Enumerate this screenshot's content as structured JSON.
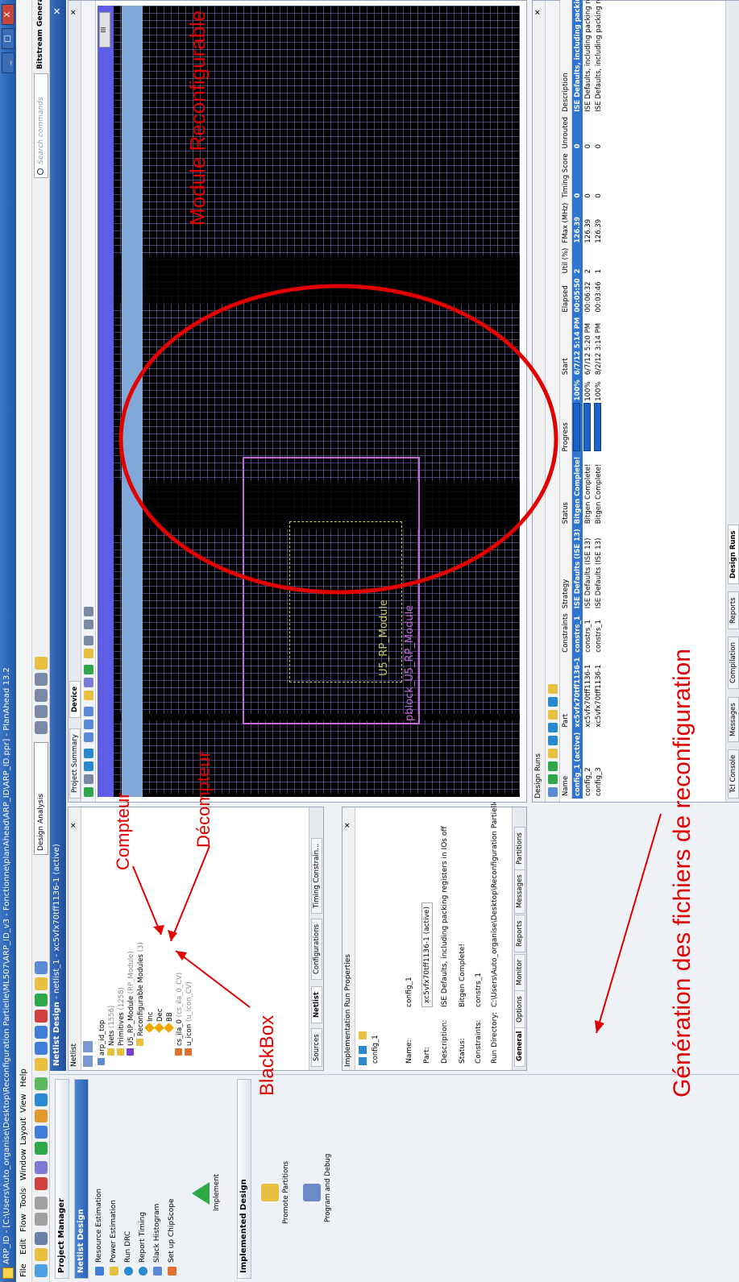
{
  "window": {
    "title": "ARP_ID - [C:\\Users\\Auto_organise\\Desktop\\Reconfiguration Partielle\\ML507\\ARP_ID_v3 - Fonctionne\\planAhead\\ARP_ID\\ARP_ID.ppr] - PlanAhead 13.2",
    "minimize": "_",
    "maximize": "□",
    "close": "X"
  },
  "menu": [
    "File",
    "Edit",
    "Flow",
    "Tools",
    "Window",
    "Layout",
    "View",
    "Help"
  ],
  "toolbar": {
    "layout_select": "Design Analysis",
    "search_placeholder": "Search commands",
    "status": "Bitstream Generated"
  },
  "flow_navigator": {
    "header": "Project Manager",
    "netlist_design": "Netlist Design",
    "items": [
      "Resource Estimation",
      "Power Estimation",
      "Run DRC",
      "Report Timing",
      "Slack Histogram",
      "Set up ChipScope"
    ],
    "implement": "Implement",
    "implemented_design": "Implemented Design",
    "promote": "Promote Partitions",
    "program": "Program and Debug"
  },
  "main_header": {
    "title": "Netlist Design",
    "subtitle": "- netlist_1 - xc5vfx70tff1136-1 (active)"
  },
  "netlist": {
    "title": "Netlist",
    "tree": [
      {
        "label": "arp_id_top",
        "extra": ""
      },
      {
        "label": "Nets",
        "extra": "(1556)"
      },
      {
        "label": "Primitives",
        "extra": "(1258)"
      },
      {
        "label": "U5_RP_Module",
        "extra": "(RP_Module)"
      },
      {
        "label": "Reconfigurable Modules",
        "extra": "(3)"
      },
      {
        "label": "Inc",
        "extra": ""
      },
      {
        "label": "Dec",
        "extra": ""
      },
      {
        "label": "BB",
        "extra": ""
      },
      {
        "label": "cs_ila_0",
        "extra": "(cs_ila_0_CV)"
      },
      {
        "label": "u_icon",
        "extra": "(u_icon_CV)"
      }
    ],
    "tabs": [
      "Sources",
      "Netlist",
      "Configurations",
      "Timing Constrain..."
    ]
  },
  "run_props": {
    "title": "Implementation Run Properties",
    "run": "config_1",
    "fields": [
      {
        "label": "Name:",
        "value": "config_1"
      },
      {
        "label": "Part:",
        "value": "xc5vfx70tff1136-1 (active)"
      },
      {
        "label": "Description:",
        "value": "ISE Defaults, including packing registers in IOs off"
      },
      {
        "label": "Status:",
        "value": "Bitgen Complete!"
      },
      {
        "label": "Constraints:",
        "value": "constrs_1"
      },
      {
        "label": "Run Directory:",
        "value": "C:\\Users\\Auto_organise\\Desktop\\Reconfiguration Partielle\\"
      }
    ],
    "tabs": [
      "General",
      "Options",
      "Monitor",
      "Reports",
      "Messages",
      "Partitions"
    ]
  },
  "device": {
    "tabs": [
      "Project Summary",
      "Device"
    ],
    "pblock_inner": "U5_RP_Module",
    "pblock_outer": "pblock_U5_RP_Module",
    "scroll_label": "III"
  },
  "design_runs": {
    "title": "Design Runs",
    "columns": [
      "Name",
      "Part",
      "Constraints",
      "Strategy",
      "Status",
      "Progress",
      "Start",
      "Elapsed",
      "Util (%)",
      "FMax (MHz)",
      "Timing Score",
      "Unrouted",
      "Description"
    ],
    "rows": [
      {
        "name": "config_1 (active)",
        "part": "xc5vfx70tff1136-1",
        "constraints": "constrs_1",
        "strategy": "ISE Defaults (ISE 13)",
        "status": "Bitgen Complete!",
        "progress": "100%",
        "start": "6/7/12 5:14 PM",
        "elapsed": "00:05:50",
        "util": "2",
        "fmax": "126.39",
        "timing": "0",
        "unrouted": "0",
        "description": "ISE Defaults, including packing registers in IOs off"
      },
      {
        "name": "config_2",
        "part": "xc5vfx70tff1136-1",
        "constraints": "constrs_1",
        "strategy": "ISE Defaults (ISE 13)",
        "status": "Bitgen Complete!",
        "progress": "100%",
        "start": "6/7/12 5:20 PM",
        "elapsed": "00:06:32",
        "util": "2",
        "fmax": "126.39",
        "timing": "0",
        "unrouted": "0",
        "description": "ISE Defaults, including packing registers in IOs off"
      },
      {
        "name": "config_3",
        "part": "xc5vfx70tff1136-1",
        "constraints": "constrs_1",
        "strategy": "ISE Defaults (ISE 13)",
        "status": "Bitgen Complete!",
        "progress": "100%",
        "start": "8/2/12 3:14 PM",
        "elapsed": "00:03:46",
        "util": "1",
        "fmax": "126.39",
        "timing": "0",
        "unrouted": "0",
        "description": "ISE Defaults, including packing registers in IOs off"
      }
    ],
    "bottom_tabs": [
      "Tcl Console",
      "Messages",
      "Compilation",
      "Reports",
      "Design Runs"
    ]
  },
  "annotations": {
    "module": "Module Reconfigurable",
    "compteur": "Compteur",
    "decompteur": "Décompteur",
    "blackbox": "BlackBox",
    "generation": "Génération des fichiers de reconfiguration"
  },
  "colors": {
    "accent": "#2f74d0",
    "annotation": "#e00000",
    "pblock": "#c46ad8"
  }
}
